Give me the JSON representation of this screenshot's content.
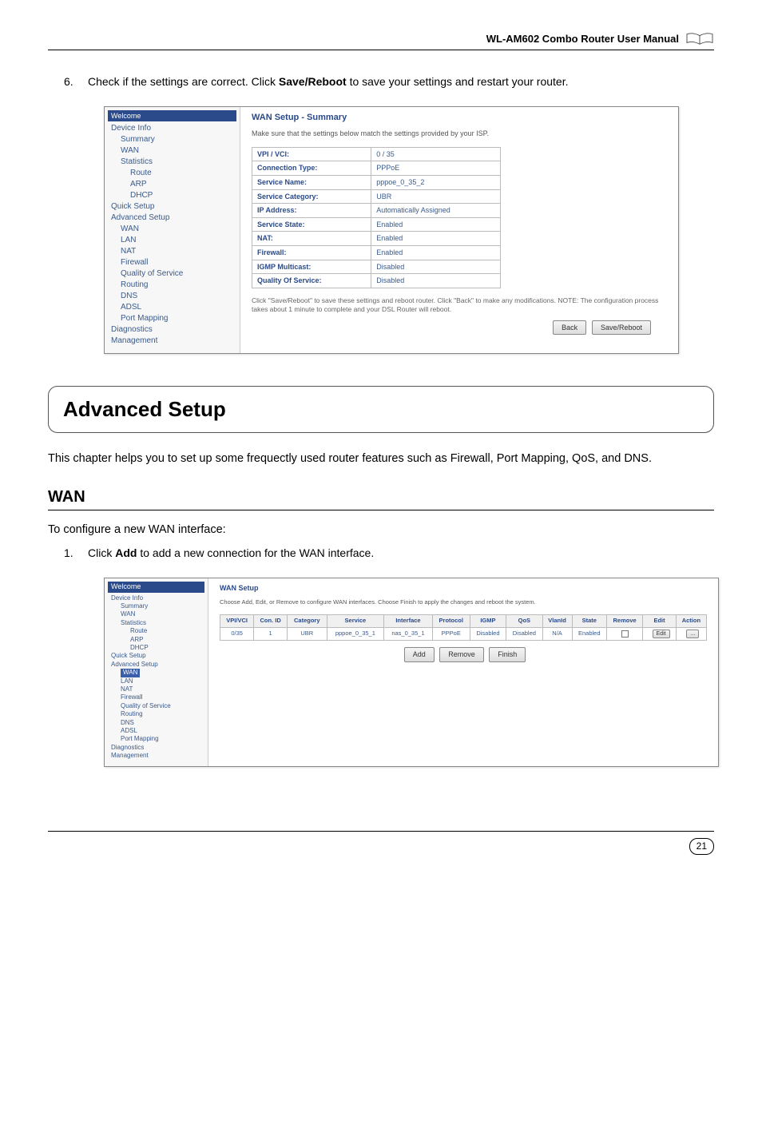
{
  "header": {
    "title": "WL-AM602 Combo Router User Manual"
  },
  "step6": {
    "num": "6.",
    "text_before": " Check if the settings are correct. Click ",
    "bold": "Save/Reboot",
    "text_after": " to save your settings and restart your router."
  },
  "screenshot1": {
    "tree_top": "Welcome",
    "tree": [
      {
        "t": "Device Info",
        "cls": ""
      },
      {
        "t": "Summary",
        "cls": "tree-indent-1"
      },
      {
        "t": "WAN",
        "cls": "tree-indent-1"
      },
      {
        "t": "Statistics",
        "cls": "tree-indent-1"
      },
      {
        "t": "Route",
        "cls": "tree-indent-2"
      },
      {
        "t": "ARP",
        "cls": "tree-indent-2"
      },
      {
        "t": "DHCP",
        "cls": "tree-indent-2"
      },
      {
        "t": "Quick Setup",
        "cls": ""
      },
      {
        "t": "Advanced Setup",
        "cls": ""
      },
      {
        "t": "WAN",
        "cls": "tree-indent-1"
      },
      {
        "t": "LAN",
        "cls": "tree-indent-1"
      },
      {
        "t": "NAT",
        "cls": "tree-indent-1"
      },
      {
        "t": "Firewall",
        "cls": "tree-indent-1"
      },
      {
        "t": "Quality of Service",
        "cls": "tree-indent-1"
      },
      {
        "t": "Routing",
        "cls": "tree-indent-1"
      },
      {
        "t": "DNS",
        "cls": "tree-indent-1"
      },
      {
        "t": "ADSL",
        "cls": "tree-indent-1"
      },
      {
        "t": "Port Mapping",
        "cls": "tree-indent-1"
      },
      {
        "t": "Diagnostics",
        "cls": ""
      },
      {
        "t": "Management",
        "cls": ""
      }
    ],
    "heading": "WAN Setup - Summary",
    "desc": "Make sure that the settings below match the settings provided by your ISP.",
    "rows": [
      [
        "VPI / VCI:",
        "0 / 35"
      ],
      [
        "Connection Type:",
        "PPPoE"
      ],
      [
        "Service Name:",
        "pppoe_0_35_2"
      ],
      [
        "Service Category:",
        "UBR"
      ],
      [
        "IP Address:",
        "Automatically Assigned"
      ],
      [
        "Service State:",
        "Enabled"
      ],
      [
        "NAT:",
        "Enabled"
      ],
      [
        "Firewall:",
        "Enabled"
      ],
      [
        "IGMP Multicast:",
        "Disabled"
      ],
      [
        "Quality Of Service:",
        "Disabled"
      ]
    ],
    "note": "Click \"Save/Reboot\" to save these settings and reboot router. Click \"Back\" to make any modifications. NOTE: The configuration process takes about 1 minute to complete and your DSL Router will reboot.",
    "btn_back": "Back",
    "btn_save": "Save/Reboot"
  },
  "advanced": {
    "title": "Advanced Setup",
    "desc": "This chapter helps you to set up some frequectly used router features such as Firewall, Port Mapping, QoS, and DNS."
  },
  "wan": {
    "title": "WAN",
    "intro": "To configure a new WAN interface:",
    "step1_num": "1.",
    "step1_before": "Click ",
    "step1_bold": "Add",
    "step1_after": " to add a new connection for the WAN interface."
  },
  "screenshot2": {
    "tree_top": "Welcome",
    "tree": [
      {
        "t": "Device Info",
        "cls": ""
      },
      {
        "t": "Summary",
        "cls": "tree-indent-1"
      },
      {
        "t": "WAN",
        "cls": "tree-indent-1"
      },
      {
        "t": "Statistics",
        "cls": "tree-indent-1"
      },
      {
        "t": "Route",
        "cls": "tree-indent-2"
      },
      {
        "t": "ARP",
        "cls": "tree-indent-2"
      },
      {
        "t": "DHCP",
        "cls": "tree-indent-2"
      },
      {
        "t": "Quick Setup",
        "cls": ""
      },
      {
        "t": "Advanced Setup",
        "cls": ""
      },
      {
        "t": "WAN",
        "cls": "tree-indent-1",
        "selected": true
      },
      {
        "t": "LAN",
        "cls": "tree-indent-1"
      },
      {
        "t": "NAT",
        "cls": "tree-indent-1"
      },
      {
        "t": "Firewall",
        "cls": "tree-indent-1"
      },
      {
        "t": "Quality of Service",
        "cls": "tree-indent-1"
      },
      {
        "t": "Routing",
        "cls": "tree-indent-1"
      },
      {
        "t": "DNS",
        "cls": "tree-indent-1"
      },
      {
        "t": "ADSL",
        "cls": "tree-indent-1"
      },
      {
        "t": "Port Mapping",
        "cls": "tree-indent-1"
      },
      {
        "t": "Diagnostics",
        "cls": ""
      },
      {
        "t": "Management",
        "cls": ""
      }
    ],
    "heading": "WAN Setup",
    "desc": "Choose Add, Edit, or Remove to configure WAN interfaces. Choose Finish to apply the changes and reboot the system.",
    "headers": [
      "VPI/VCI",
      "Con. ID",
      "Category",
      "Service",
      "Interface",
      "Protocol",
      "IGMP",
      "QoS",
      "VlanId",
      "State",
      "Remove",
      "Edit",
      "Action"
    ],
    "row": [
      "0/35",
      "1",
      "UBR",
      "pppoe_0_35_1",
      "nas_0_35_1",
      "PPPoE",
      "Disabled",
      "Disabled",
      "N/A",
      "Enabled",
      "",
      "",
      ""
    ],
    "btn_add": "Add",
    "btn_remove": "Remove",
    "btn_finish": "Finish"
  },
  "page_number": "21"
}
